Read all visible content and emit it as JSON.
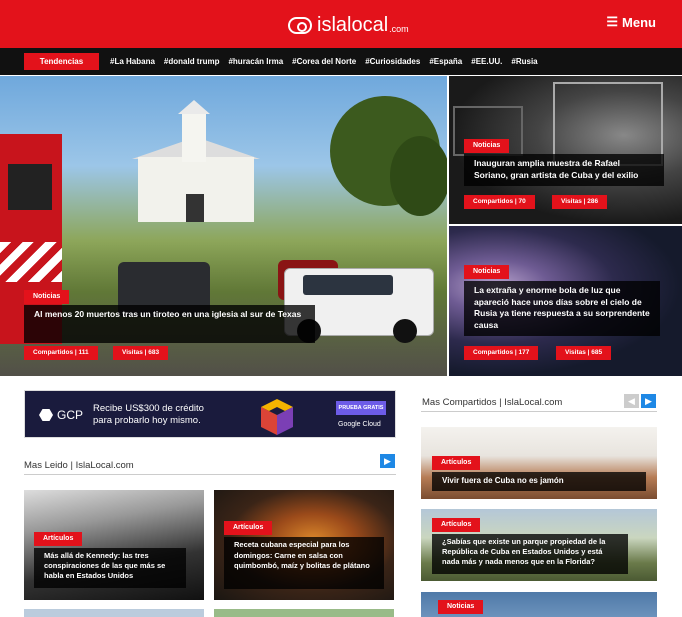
{
  "header": {
    "logo_text": "islalocal",
    "logo_domain": ".com",
    "menu_label": "Menu"
  },
  "trends": {
    "label": "Tendencias",
    "items": [
      "#La Habana",
      "#donald trump",
      "#huracán Irma",
      "#Corea del Norte",
      "#Curiosidades",
      "#España",
      "#EE.UU.",
      "#Rusia"
    ]
  },
  "hero": {
    "main": {
      "category": "Noticias",
      "title": "Al menos 20 muertos tras un tiroteo en una iglesia al sur de Texas",
      "shared": "Compartidos | 111",
      "visits": "Visitas | 683"
    },
    "top_right": {
      "category": "Noticias",
      "title": "Inauguran amplia muestra de Rafael Soriano, gran artista de Cuba y del exilio",
      "shared": "Compartidos | 70",
      "visits": "Visitas | 286"
    },
    "bottom_right": {
      "category": "Noticias",
      "title": "La extraña y enorme bola de luz que apareció hace unos días sobre el cielo de Rusia ya tiene respuesta a su sorprendente causa",
      "shared": "Compartidos | 177",
      "visits": "Visitas | 685"
    }
  },
  "ad": {
    "brand": "GCP",
    "text": "Recibe US$300 de crédito para probarlo hoy mismo.",
    "trial": "PRUEBA GRATIS",
    "cloud": "Google Cloud"
  },
  "most_read": {
    "title": "Mas Leido  |  IslaLocal.com",
    "next_icon": "chevron-right-icon",
    "cards": [
      {
        "category": "Artículos",
        "title": "Más allá de Kennedy: las tres conspiraciones de las que más se habla en Estados Unidos"
      },
      {
        "category": "Artículos",
        "title": "Receta cubana especial para los domingos: Carne en salsa con quimbombó, maíz y bolitas de plátano"
      }
    ]
  },
  "most_shared": {
    "title": "Mas Compartidos  |  IslaLocal.com",
    "prev_icon": "chevron-left-icon",
    "next_icon": "chevron-right-icon",
    "cards": [
      {
        "category": "Artículos",
        "title": "Vivir fuera de Cuba no es jamón"
      },
      {
        "category": "Artículos",
        "title": "¿Sabías que existe un parque propiedad de la República de Cuba en Estados Unidos y está nada más y nada menos que en la Florida?"
      },
      {
        "category": "Noticias"
      }
    ]
  },
  "colors": {
    "brand_red": "#e3121b",
    "arrow_blue": "#1e88e5",
    "arrow_disabled": "#cccccc"
  }
}
